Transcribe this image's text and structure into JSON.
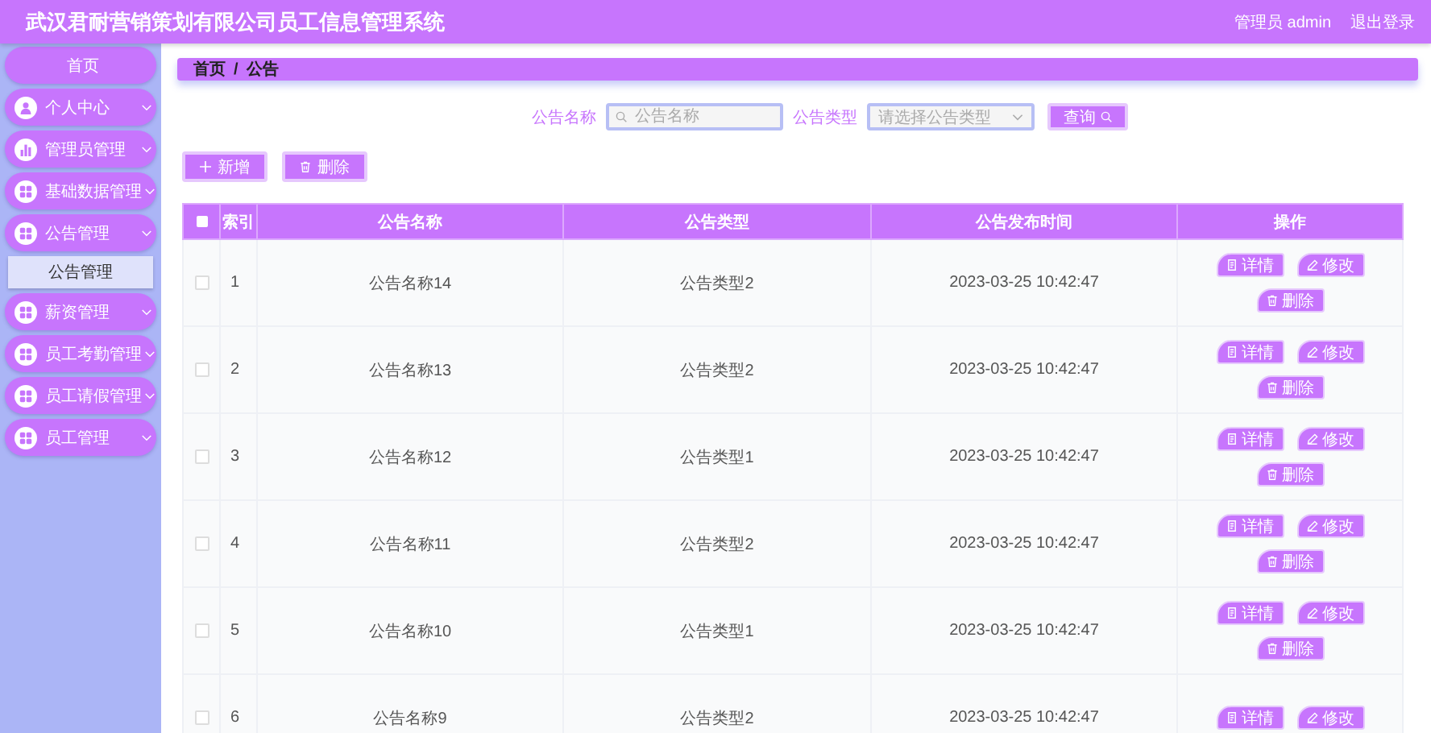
{
  "header": {
    "title": "武汉君耐营销策划有限公司员工信息管理系统",
    "user": "管理员 admin",
    "logout": "退出登录"
  },
  "sidebar": {
    "items": [
      {
        "kind": "home",
        "label": "首页"
      },
      {
        "kind": "user",
        "label": "个人中心"
      },
      {
        "kind": "chart",
        "label": "管理员管理"
      },
      {
        "kind": "grid",
        "label": "基础数据管理"
      },
      {
        "kind": "grid",
        "label": "公告管理",
        "children": [
          {
            "label": "公告管理",
            "selected": true
          }
        ]
      },
      {
        "kind": "grid",
        "label": "薪资管理"
      },
      {
        "kind": "grid",
        "label": "员工考勤管理"
      },
      {
        "kind": "grid",
        "label": "员工请假管理"
      },
      {
        "kind": "grid",
        "label": "员工管理"
      }
    ]
  },
  "breadcrumb": {
    "items": [
      "首页",
      "公告"
    ],
    "separator": "/"
  },
  "search": {
    "fields": [
      {
        "kind": "input",
        "label": "公告名称",
        "placeholder": "公告名称"
      },
      {
        "kind": "select",
        "label": "公告类型",
        "placeholder": "请选择公告类型"
      }
    ],
    "button": "查询"
  },
  "actions": [
    {
      "kind": "add",
      "label": "新增"
    },
    {
      "kind": "delete",
      "label": "删除"
    }
  ],
  "table": {
    "all_checked": false,
    "columns": [
      "索引",
      "公告名称",
      "公告类型",
      "公告发布时间",
      "操作"
    ],
    "rows": [
      {
        "checked": false,
        "cells": [
          "1",
          "公告名称14",
          "公告类型2",
          "2023-03-25 10:42:47"
        ],
        "actions": [
          {
            "kind": "detail",
            "label": "详情"
          },
          {
            "kind": "edit",
            "label": "修改"
          },
          {
            "kind": "delete",
            "label": "删除"
          }
        ]
      },
      {
        "checked": false,
        "cells": [
          "2",
          "公告名称13",
          "公告类型2",
          "2023-03-25 10:42:47"
        ],
        "actions": [
          {
            "kind": "detail",
            "label": "详情"
          },
          {
            "kind": "edit",
            "label": "修改"
          },
          {
            "kind": "delete",
            "label": "删除"
          }
        ]
      },
      {
        "checked": false,
        "cells": [
          "3",
          "公告名称12",
          "公告类型1",
          "2023-03-25 10:42:47"
        ],
        "actions": [
          {
            "kind": "detail",
            "label": "详情"
          },
          {
            "kind": "edit",
            "label": "修改"
          },
          {
            "kind": "delete",
            "label": "删除"
          }
        ]
      },
      {
        "checked": false,
        "cells": [
          "4",
          "公告名称11",
          "公告类型2",
          "2023-03-25 10:42:47"
        ],
        "actions": [
          {
            "kind": "detail",
            "label": "详情"
          },
          {
            "kind": "edit",
            "label": "修改"
          },
          {
            "kind": "delete",
            "label": "删除"
          }
        ]
      },
      {
        "checked": false,
        "cells": [
          "5",
          "公告名称10",
          "公告类型1",
          "2023-03-25 10:42:47"
        ],
        "actions": [
          {
            "kind": "detail",
            "label": "详情"
          },
          {
            "kind": "edit",
            "label": "修改"
          },
          {
            "kind": "delete",
            "label": "删除"
          }
        ]
      },
      {
        "checked": false,
        "cells": [
          "6",
          "公告名称9",
          "公告类型2",
          "2023-03-25 10:42:47"
        ],
        "actions": [
          {
            "kind": "detail",
            "label": "详情"
          },
          {
            "kind": "edit",
            "label": "修改"
          }
        ]
      }
    ]
  }
}
